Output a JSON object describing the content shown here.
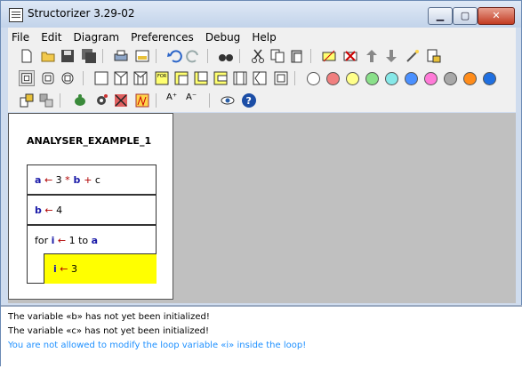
{
  "window": {
    "title": "Structorizer 3.29-02",
    "minimize": "▁",
    "maximize": "▢",
    "close": "✕"
  },
  "menu": [
    "File",
    "Edit",
    "Diagram",
    "Preferences",
    "Debug",
    "Help"
  ],
  "palette": [
    "#ffffff",
    "#f07f7f",
    "#ffff8a",
    "#8ae08a",
    "#86e8e8",
    "#4a90ff",
    "#ff7ad8",
    "#a8a8a8",
    "#ff8c1a",
    "#1f6fe0"
  ],
  "diagram": {
    "name": "ANALYSER_EXAMPLE_1",
    "statements": [
      {
        "var": "a",
        "op": "←",
        "expr": " 3 ",
        "mul": "*",
        "rhs1": " b ",
        "plus": "+",
        "rhs2": " c"
      },
      {
        "var": "b",
        "op": "←",
        "expr": " 4"
      }
    ],
    "loop": {
      "header_pre": "for ",
      "var": "i",
      "arrow": " ← ",
      "rest": " 1 to ",
      "end": "a"
    },
    "loop_body": {
      "var": "i",
      "op": "←",
      "expr": " 3"
    },
    "highlight_color": "#ffff00"
  },
  "messages": [
    {
      "text": "The variable «b» has not yet been initialized!",
      "color": "#000000"
    },
    {
      "text": "The variable «c» has not yet been initialized!",
      "color": "#000000"
    },
    {
      "text": "You are not allowed to modify the loop variable «i» inside the loop!",
      "color": "#1e90ff"
    }
  ]
}
